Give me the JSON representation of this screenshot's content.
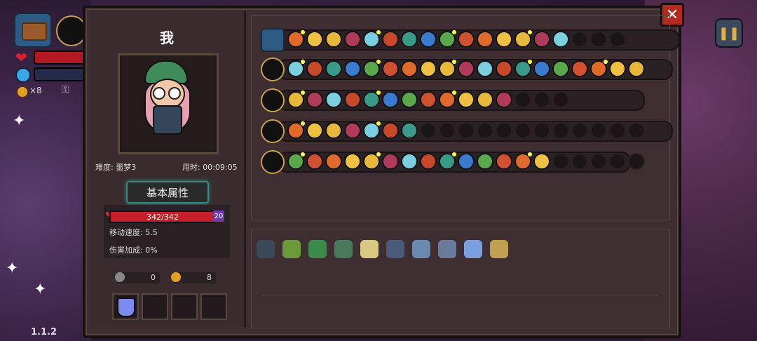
{
  "hud": {
    "coin_count": "×8",
    "version": "1.1.2"
  },
  "panel": {
    "player_name": "我",
    "difficulty": "难度: 噩梦3",
    "time": "用时: 00:09:05",
    "tab_label": "基本属性",
    "hp_text": "342/342",
    "hp_extra": "20",
    "move_speed": "移动速度: 5.5",
    "damage_bonus": "伤害加成: 0%",
    "keys": "0",
    "coins": "8"
  },
  "icons": {
    "close": "✕",
    "pause": "❚❚",
    "key": "⚿",
    "heart": "❤"
  },
  "colors": {
    "accent_gold": "#caa04a",
    "hp_red": "#c81e28",
    "mana_blue": "#3aa8e8",
    "panel_bg": "#3e2d31"
  }
}
